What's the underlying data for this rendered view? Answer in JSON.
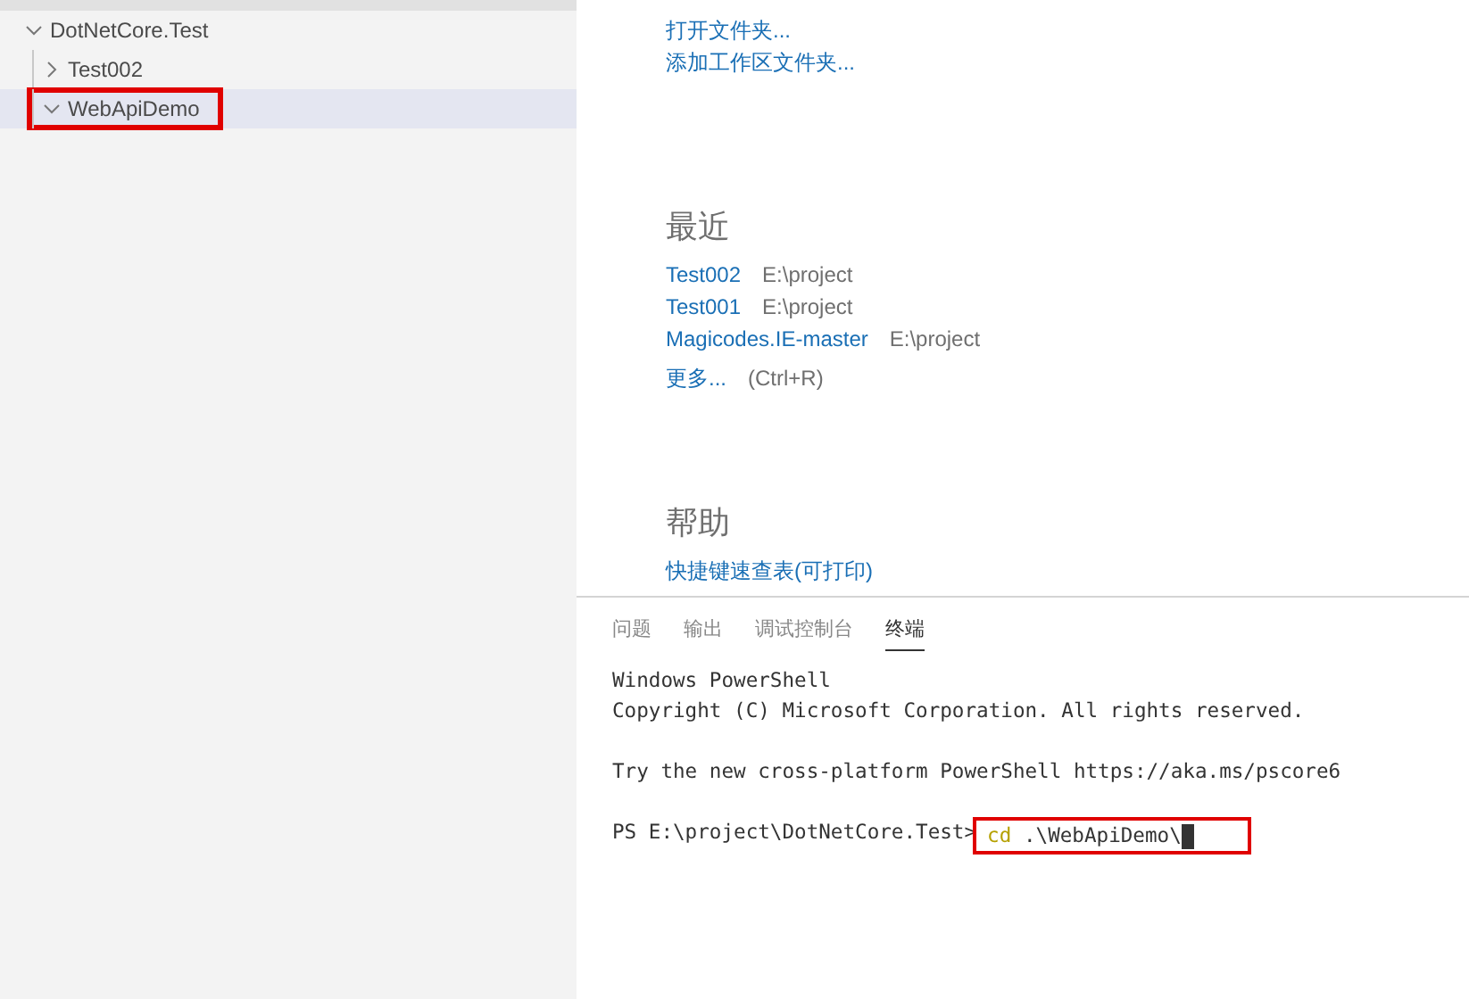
{
  "explorer": {
    "items": [
      {
        "label": "DotNetCore.Test",
        "expanded": true,
        "selected": false,
        "highlighted": false,
        "children": [
          {
            "label": "Test002",
            "expanded": false,
            "selected": false,
            "highlighted": false
          },
          {
            "label": "WebApiDemo",
            "expanded": true,
            "selected": true,
            "highlighted": true
          }
        ]
      }
    ]
  },
  "welcome": {
    "start_links": [
      "打开文件夹...",
      "添加工作区文件夹..."
    ],
    "recent": {
      "title": "最近",
      "items": [
        {
          "name": "Test002",
          "path": "E:\\project"
        },
        {
          "name": "Test001",
          "path": "E:\\project"
        },
        {
          "name": "Magicodes.IE-master",
          "path": "E:\\project"
        }
      ],
      "more": {
        "label": "更多...",
        "shortcut": "(Ctrl+R)"
      }
    },
    "help": {
      "title": "帮助",
      "links": [
        "快捷键速查表(可打印)"
      ]
    }
  },
  "panel": {
    "tabs": [
      {
        "label": "问题",
        "selected": false
      },
      {
        "label": "输出",
        "selected": false
      },
      {
        "label": "调试控制台",
        "selected": false
      },
      {
        "label": "终端",
        "selected": true
      }
    ],
    "terminal": {
      "blocks": [
        [
          "Windows PowerShell",
          "Copyright (C) Microsoft Corporation. All rights reserved."
        ],
        [
          "Try the new cross-platform PowerShell https://aka.ms/pscore6"
        ]
      ],
      "prompt": "PS E:\\project\\DotNetCore.Test>",
      "command": "cd",
      "argument": ".\\WebApiDemo\\",
      "highlighted": true
    }
  }
}
